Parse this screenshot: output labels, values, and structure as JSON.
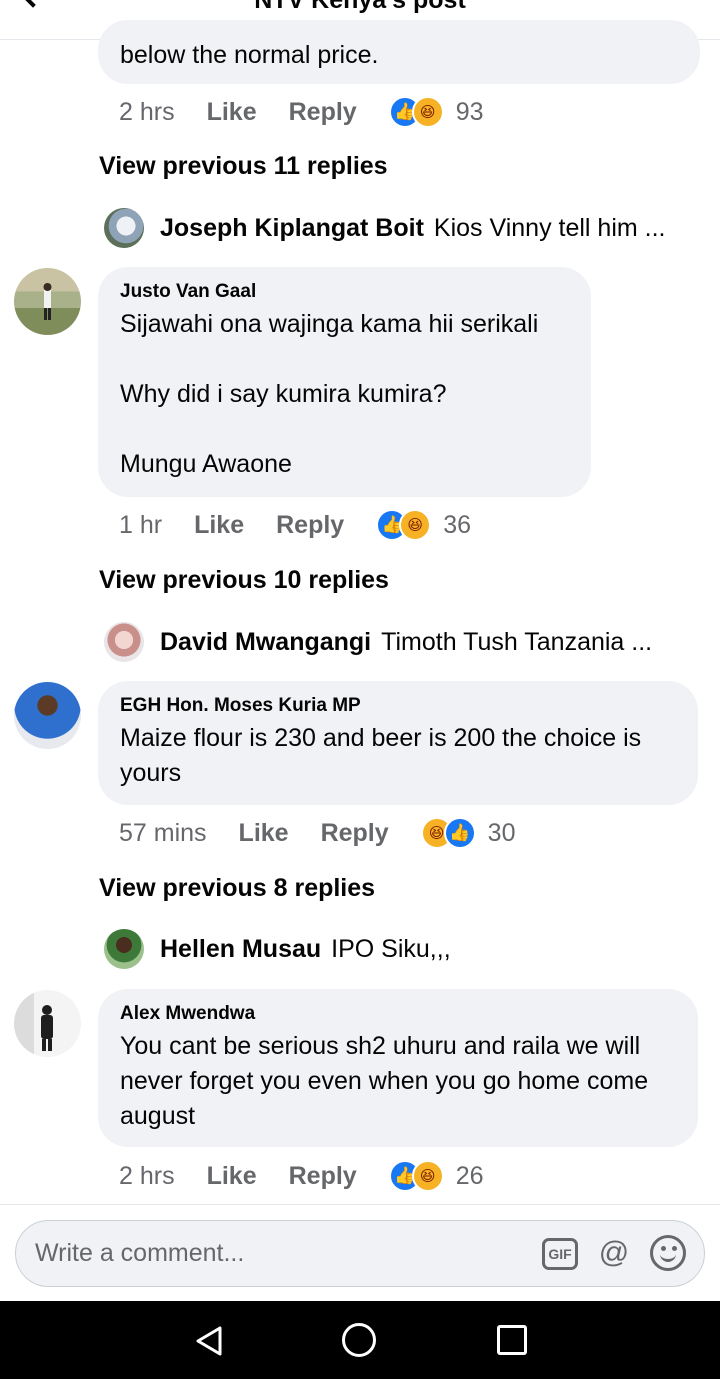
{
  "header": {
    "title": "NTV Kenya's post"
  },
  "top_comment": {
    "text_tail": "below the normal price.",
    "time": "2 hrs",
    "like_label": "Like",
    "reply_label": "Reply",
    "reactions": [
      "like",
      "haha"
    ],
    "reaction_count": "93"
  },
  "threads": [
    {
      "view_previous": "View previous 11 replies",
      "reply_preview": {
        "name": "Joseph Kiplangat Boit",
        "text": "Kios Vinny tell him ..."
      },
      "comment": {
        "author": "Justo Van Gaal",
        "text": "Sijawahi ona wajinga kama hii serikali\n\nWhy did i say kumira kumira?\n\nMungu Awaone",
        "time": "1 hr",
        "like_label": "Like",
        "reply_label": "Reply",
        "reactions": [
          "like",
          "haha"
        ],
        "reaction_count": "36"
      }
    },
    {
      "view_previous": "View previous 10 replies",
      "reply_preview": {
        "name": "David Mwangangi",
        "text": "Timoth Tush Tanzania ..."
      },
      "comment": {
        "author": "EGH Hon. Moses Kuria MP",
        "text": "Maize flour is 230 and beer is 200 the choice is yours",
        "time": "57 mins",
        "like_label": "Like",
        "reply_label": "Reply",
        "reactions": [
          "haha",
          "like"
        ],
        "reaction_count": "30"
      }
    },
    {
      "view_previous": "View previous 8 replies",
      "reply_preview": {
        "name": "Hellen Musau",
        "text": "IPO Siku,,,"
      },
      "comment": {
        "author": "Alex Mwendwa",
        "text": "You cant be serious sh2 uhuru and raila we will never forget you even when you go home come august",
        "time": "2 hrs",
        "like_label": "Like",
        "reply_label": "Reply",
        "reactions": [
          "like",
          "haha"
        ],
        "reaction_count": "26"
      }
    }
  ],
  "composer": {
    "placeholder": "Write a comment...",
    "gif_label": "GIF",
    "at_symbol": "@"
  },
  "icons": {
    "like_reaction": "thumbs-up-icon",
    "haha_reaction": "laughing-face-icon",
    "back": "back-arrow-icon",
    "nav_back": "triangle-back-icon",
    "nav_home": "circle-home-icon",
    "nav_recent": "square-recents-icon"
  },
  "colors": {
    "like_blue": "#1877f2",
    "haha_yellow": "#f7b125",
    "bubble_gray": "#f0f2f5",
    "meta_gray": "#65676b"
  }
}
